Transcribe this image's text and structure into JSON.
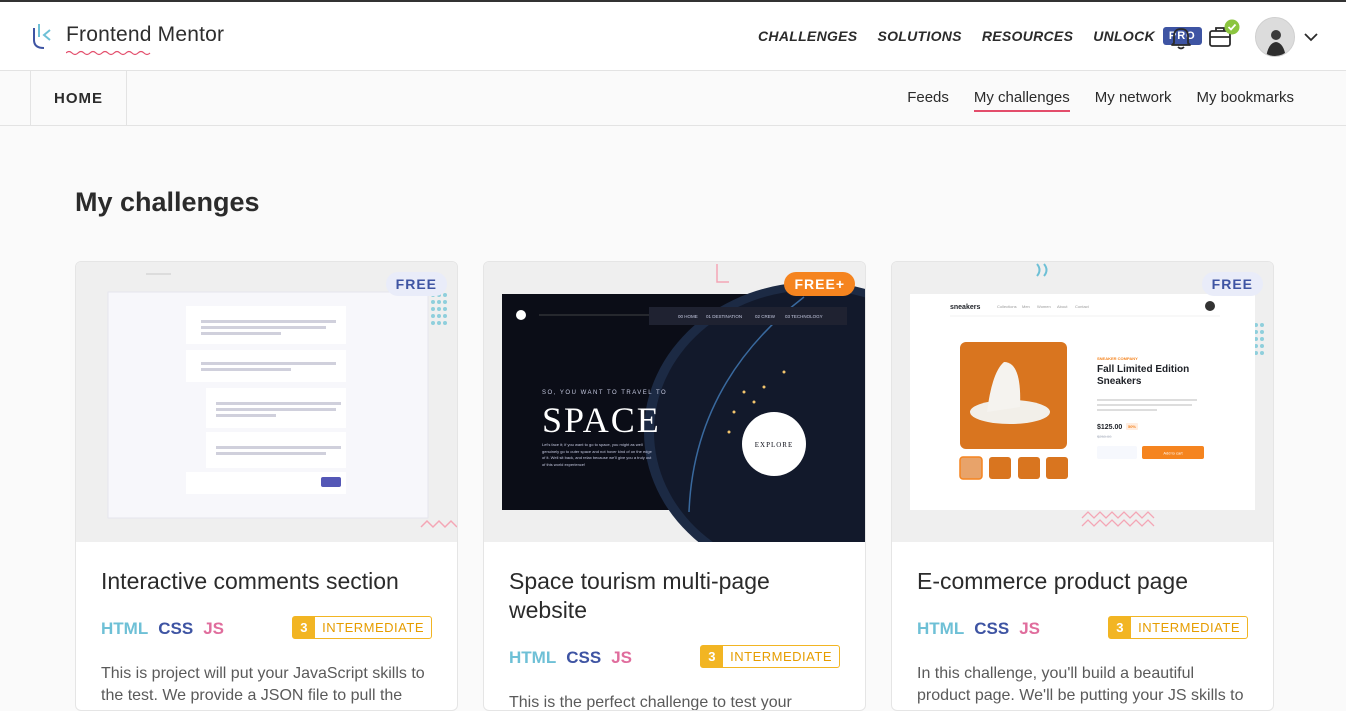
{
  "brand": {
    "name": "Frontend Mentor"
  },
  "nav": {
    "items": [
      "CHALLENGES",
      "SOLUTIONS",
      "RESOURCES",
      "UNLOCK"
    ],
    "pro_label": "PRO"
  },
  "subnav": {
    "home": "HOME",
    "items": [
      "Feeds",
      "My challenges",
      "My network",
      "My bookmarks"
    ],
    "active": "My challenges"
  },
  "page": {
    "title": "My challenges"
  },
  "cards": [
    {
      "title": "Interactive comments section",
      "badge": "FREE",
      "tags": [
        "HTML",
        "CSS",
        "JS"
      ],
      "level_num": "3",
      "level": "INTERMEDIATE",
      "description": "This is project will put your JavaScript skills to the test. We provide a JSON file to pull the"
    },
    {
      "title": "Space tourism multi-page website",
      "badge": "FREE+",
      "tags": [
        "HTML",
        "CSS",
        "JS"
      ],
      "level_num": "3",
      "level": "INTERMEDIATE",
      "description": "This is the perfect challenge to test your",
      "preview": {
        "tagline": "SO, YOU WANT TO TRAVEL TO",
        "headline": "SPACE",
        "cta": "EXPLORE",
        "menu": [
          "00 HOME",
          "01 DESTINATION",
          "02 CREW",
          "03 TECHNOLOGY"
        ],
        "body": "Let's face it; if you want to go to space, you might as well genuinely go to outer space and not hover kind of on the edge of it. Well sit back, and relax because we'll give you a truly out of this world experience!"
      }
    },
    {
      "title": "E-commerce product page",
      "badge": "FREE",
      "tags": [
        "HTML",
        "CSS",
        "JS"
      ],
      "level_num": "3",
      "level": "INTERMEDIATE",
      "description": "In this challenge, you'll build a beautiful product page. We'll be putting your JS skills to",
      "preview": {
        "brand": "sneakers",
        "company": "SNEAKER COMPANY",
        "product": "Fall Limited Edition Sneakers",
        "price": "$125.00",
        "discount": "50%",
        "old_price": "$250.00",
        "add": "Add to cart",
        "menu": [
          "Collections",
          "Men",
          "Women",
          "About",
          "Contact"
        ]
      }
    }
  ],
  "colors": {
    "accent": "#e34d6b",
    "pro": "#3e54a3",
    "free_plus": "#f5841f",
    "level": "#f2b523"
  },
  "icons": [
    "bell-icon",
    "briefcase-icon",
    "check-icon",
    "chevron-down-icon"
  ]
}
